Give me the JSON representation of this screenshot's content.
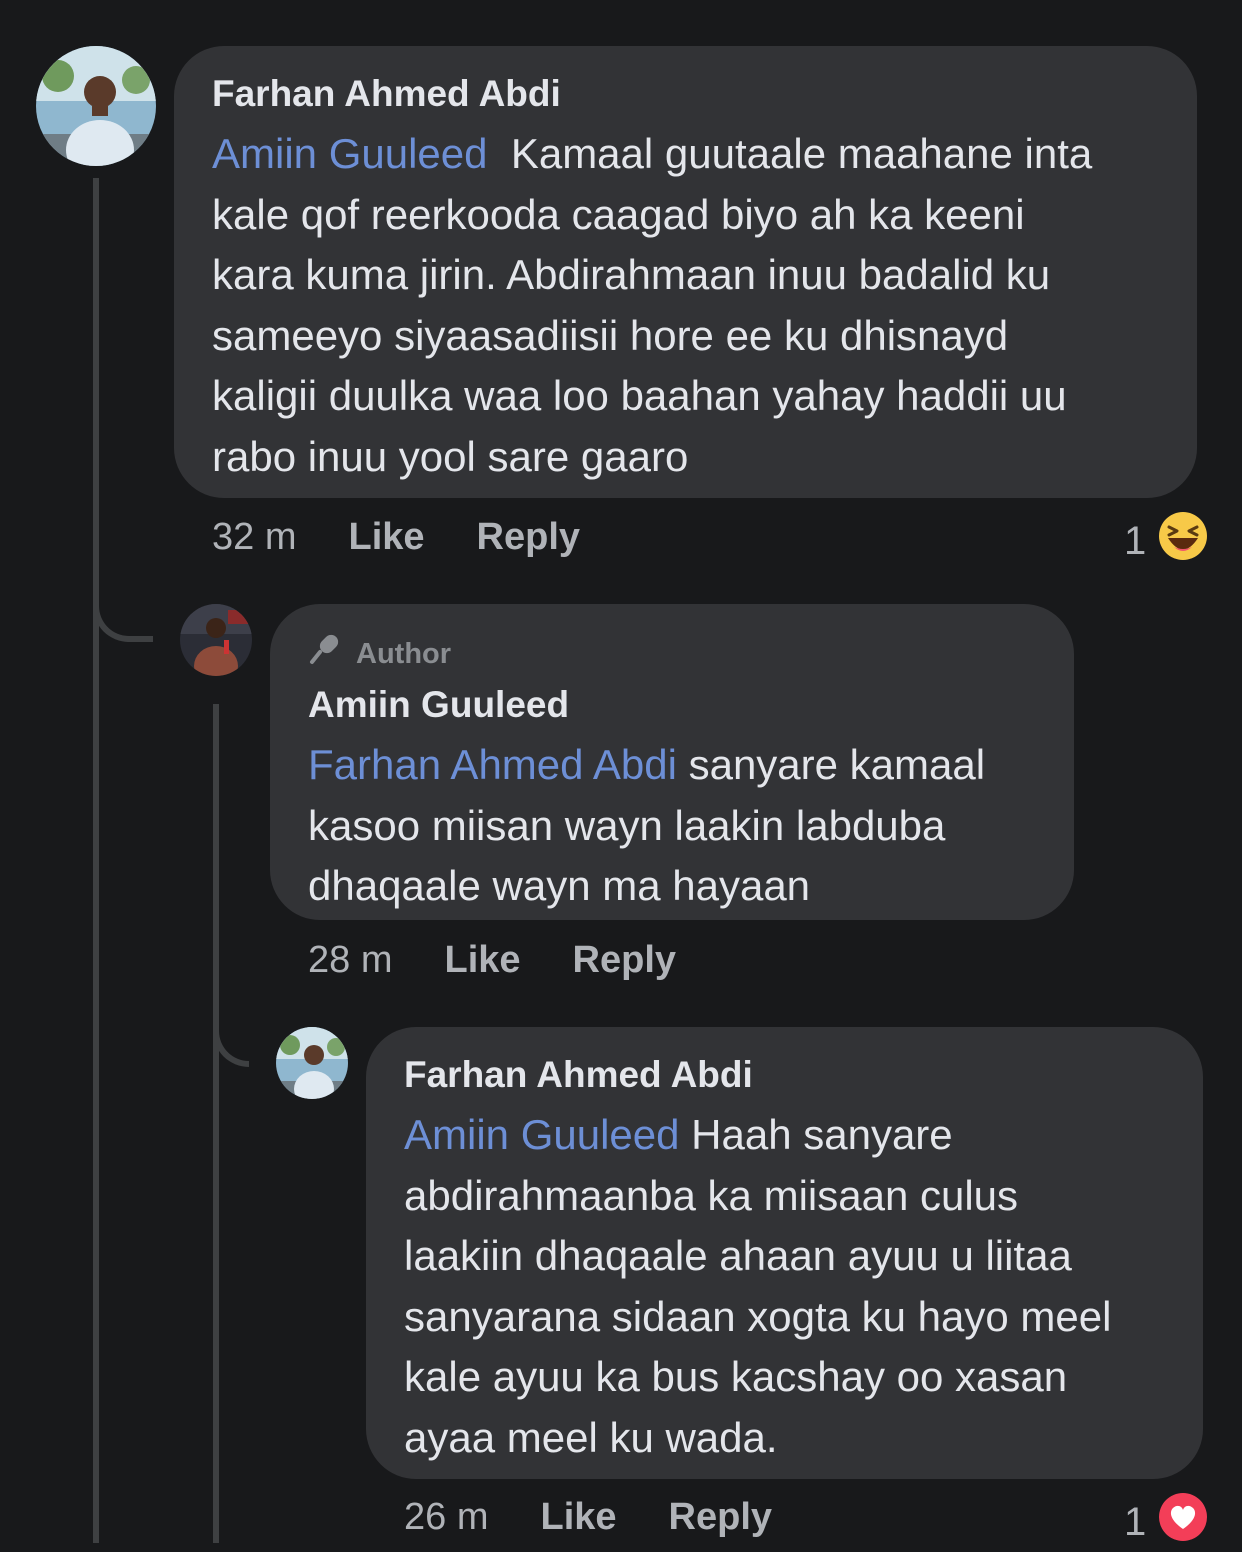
{
  "comments": [
    {
      "author": "Farhan Ahmed Abdi",
      "mention": "Amiin Guuleed",
      "text_lines": [
        "Kamaal guutaale maahane inta",
        "kale qof reerkooda caagad biyo ah ka keeni",
        "kara kuma jirin. Abdirahmaan inuu badalid ku",
        "sameeyo siyaasadiisii hore ee ku dhisnayd",
        "kaligii duulka waa loo baahan yahay haddii uu",
        "rabo inuu yool sare gaaro"
      ],
      "time": "32 m",
      "like": "Like",
      "reply": "Reply",
      "reaction_count": "1",
      "reaction_icon": "haha-emoji-icon"
    },
    {
      "badge": "Author",
      "badge_icon": "microphone-icon",
      "author": "Amiin Guuleed",
      "mention": "Farhan Ahmed Abdi",
      "text_lines": [
        "sanyare kamaal",
        "kasoo miisan wayn laakin labduba",
        "dhaqaale wayn ma hayaan"
      ],
      "time": "28 m",
      "like": "Like",
      "reply": "Reply"
    },
    {
      "author": "Farhan Ahmed Abdi",
      "mention": "Amiin Guuleed",
      "text_lines": [
        "Haah sanyare",
        "abdirahmaanba ka miisaan culus",
        "laakiin dhaqaale ahaan ayuu u liitaa",
        "sanyarana sidaan xogta ku hayo meel",
        "kale ayuu ka bus kacshay oo xasan",
        "ayaa meel ku wada."
      ],
      "time": "26 m",
      "like": "Like",
      "reply": "Reply",
      "reaction_count": "1",
      "reaction_icon": "love-heart-icon"
    }
  ],
  "colors": {
    "background": "#18191b",
    "bubble": "#323336",
    "mention": "#6d8fd6",
    "text": "#e4e6eb",
    "secondary": "#b0b3b8",
    "haha_yellow": "#f7c948",
    "love_red": "#f33e58"
  }
}
